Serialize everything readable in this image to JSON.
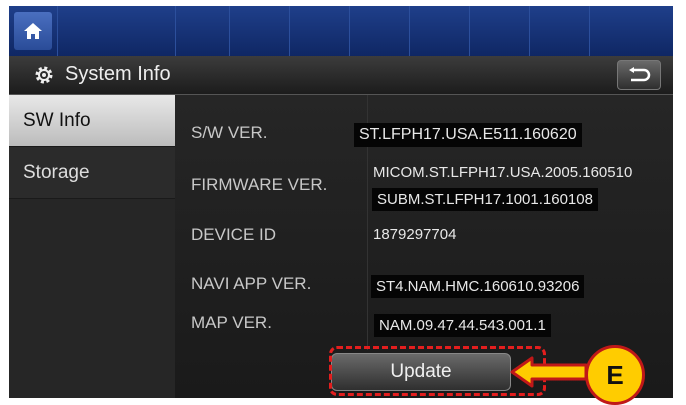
{
  "header": {
    "home_icon": "home-icon"
  },
  "titlebar": {
    "title": "System Info",
    "settings_icon": "gear-icon",
    "back_icon": "back-arrow-icon"
  },
  "sidebar": {
    "items": [
      {
        "label": "SW Info",
        "active": true
      },
      {
        "label": "Storage",
        "active": false
      }
    ]
  },
  "info": {
    "sw_ver_label": "S/W VER.",
    "sw_ver_value": "ST.LFPH17.USA.E511.160620",
    "firmware_label": "FIRMWARE VER.",
    "firmware_value_1": "MICOM.ST.LFPH17.USA.2005.160510",
    "firmware_value_2": "SUBM.ST.LFPH17.1001.160108",
    "device_id_label": "DEVICE ID",
    "device_id_value": "1879297704",
    "navi_label": "NAVI APP VER.",
    "navi_value": "ST4.NAM.HMC.160610.93206",
    "map_label": "MAP VER.",
    "map_value": "NAM.09.47.44.543.001.1"
  },
  "update_button": {
    "label": "Update"
  },
  "callout": {
    "letter": "E",
    "color": "#e31e1e",
    "badge_color": "#ffcc00"
  }
}
